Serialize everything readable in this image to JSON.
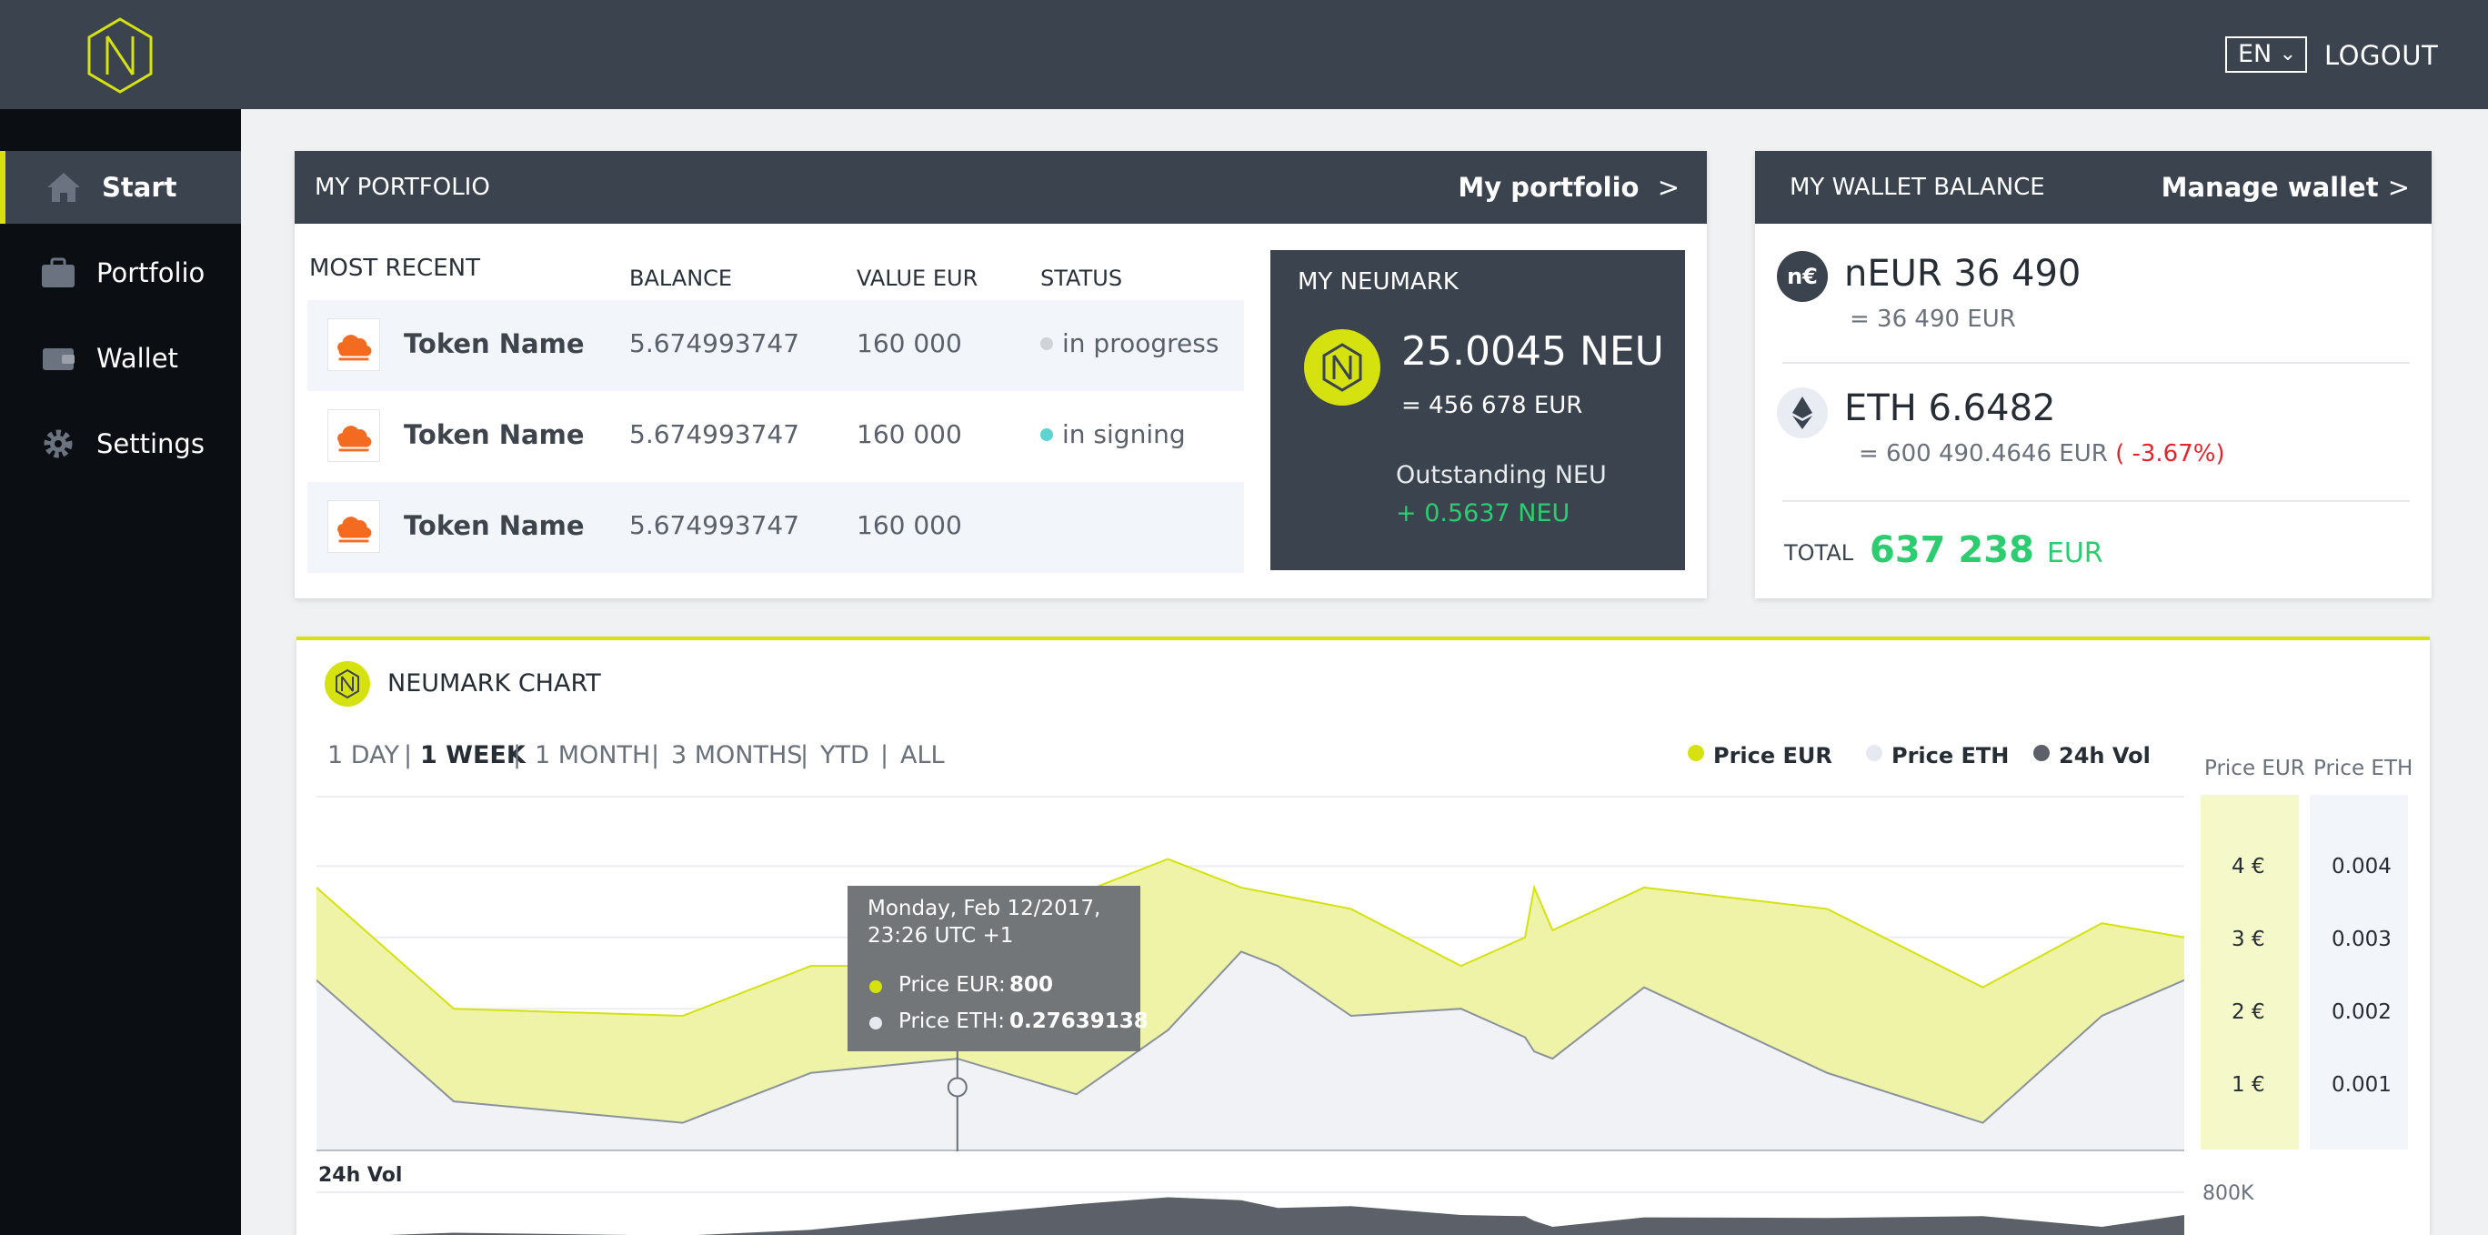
{
  "header": {
    "language": "EN",
    "logout_label": "LOGOUT"
  },
  "colors": {
    "topbar": "#3a434e",
    "sidebar": "#0b0e12",
    "accent": "#d5e20f",
    "positive": "#2ecc71",
    "negative": "#e0262c"
  },
  "sidebar": {
    "items": [
      {
        "label": "Start",
        "icon": "home-icon",
        "active": true
      },
      {
        "label": "Portfolio",
        "icon": "briefcase-icon",
        "active": false
      },
      {
        "label": "Wallet",
        "icon": "wallet-icon",
        "active": false
      },
      {
        "label": "Settings",
        "icon": "gear-icon",
        "active": false
      }
    ]
  },
  "portfolio": {
    "title": "MY PORTFOLIO",
    "link_label": "My portfolio",
    "link_arrow": ">",
    "section_label": "MOST RECENT",
    "columns": [
      "BALANCE",
      "VALUE EUR",
      "STATUS"
    ],
    "rows": [
      {
        "token": "Token Name",
        "balance": "5.674993747",
        "value": "160 000",
        "status": "in proogress",
        "status_color": "#cfd2d6"
      },
      {
        "token": "Token Name",
        "balance": "5.674993747",
        "value": "160 000",
        "status": "in signing",
        "status_color": "#5fd3d0"
      },
      {
        "token": "Token Name",
        "balance": "5.674993747",
        "value": "160 000",
        "status": "",
        "status_color": ""
      }
    ],
    "neumark": {
      "title": "MY NEUMARK",
      "amount": "25.0045 NEU",
      "eur": "= 456 678 EUR",
      "outstanding_label": "Outstanding NEU",
      "outstanding_value": "+ 0.5637 NEU"
    }
  },
  "wallet": {
    "title": "MY WALLET BALANCE",
    "link_label": "Manage wallet",
    "link_arrow": ">",
    "neur_icon_text": "n€",
    "neur_amount": "nEUR 36 490",
    "neur_eur": "= 36 490 EUR",
    "eth_amount": "ETH 6.6482",
    "eth_eur": "= 600 490.4646 EUR",
    "eth_change": "( -3.67%)",
    "total_label": "TOTAL",
    "total_value": "637 238",
    "total_unit": "EUR"
  },
  "chart": {
    "title": "NEUMARK CHART",
    "ranges": [
      "1 DAY",
      "1 WEEK",
      "1 MONTH",
      "3 MONTHS",
      "YTD",
      "ALL"
    ],
    "active_range": "1 WEEK",
    "range_separator": "|",
    "legend": [
      {
        "label": "Price EUR",
        "color": "#d5e20f"
      },
      {
        "label": "Price ETH",
        "color": "#e6eaf0"
      },
      {
        "label": "24h Vol",
        "color": "#5c6169"
      }
    ],
    "axis_headers": {
      "eur": "Price EUR",
      "eth": "Price ETH"
    },
    "eur_ticks": [
      "4 €",
      "3 €",
      "2 €",
      "1 €"
    ],
    "eth_ticks": [
      "0.004",
      "0.003",
      "0.002",
      "0.001"
    ],
    "vol_label": "24h Vol",
    "vol_tick": "800K",
    "tooltip": {
      "date": "Monday, Feb 12/2017,",
      "time": "23:26 UTC +1",
      "eur_label": "Price EUR:",
      "eur_value": "800",
      "eth_label": "Price ETH:",
      "eth_value": "0.27639138"
    }
  },
  "chart_data": {
    "type": "area",
    "title": "NEUMARK CHART",
    "xlabel": "",
    "ylabel": "",
    "ylim": [
      0,
      5
    ],
    "y2lim": [
      0,
      0.005
    ],
    "grid": true,
    "legend": "top-right",
    "x": [
      0,
      1.5,
      4,
      5.4,
      7,
      8.3,
      9.3,
      10.1,
      10.5,
      11.3,
      12.5,
      13.2,
      13.3,
      13.5,
      14.5,
      16.5,
      18.2,
      19.5,
      20.4
    ],
    "series": [
      {
        "name": "Price EUR",
        "axis": "left",
        "values": [
          3.7,
          2.0,
          1.9,
          2.6,
          2.6,
          3.6,
          4.1,
          3.7,
          3.6,
          3.4,
          2.6,
          3.0,
          3.7,
          3.1,
          3.7,
          3.4,
          2.3,
          3.2,
          3.0
        ]
      },
      {
        "name": "Price ETH",
        "axis": "right",
        "values": [
          0.0024,
          0.0007,
          0.0004,
          0.0011,
          0.0013,
          0.0008,
          0.0017,
          0.0028,
          0.0026,
          0.0019,
          0.002,
          0.0016,
          0.0014,
          0.0013,
          0.0023,
          0.0011,
          0.0004,
          0.0019,
          0.0024
        ]
      },
      {
        "name": "24h Vol",
        "axis": "vol",
        "values": [
          20,
          100,
          50,
          150,
          400,
          580,
          700,
          650,
          520,
          550,
          400,
          380,
          300,
          200,
          360,
          350,
          380,
          200,
          400
        ]
      }
    ]
  }
}
